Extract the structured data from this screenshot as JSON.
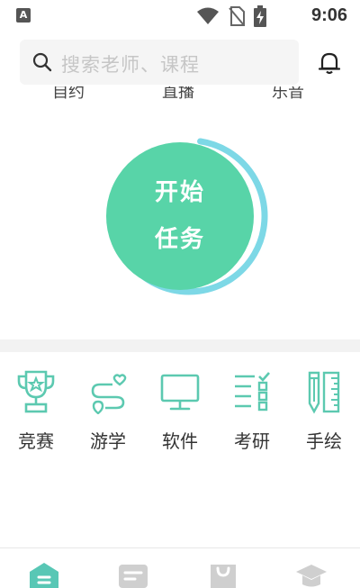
{
  "status": {
    "time": "9:06",
    "app_badge": "A"
  },
  "search": {
    "placeholder": "搜索老师、课程"
  },
  "cutoff_labels": [
    "自约",
    "直播",
    "乐音"
  ],
  "task_button": {
    "line1": "开始",
    "line2": "任务",
    "progress": 0.62
  },
  "categories": [
    {
      "label": "竞赛",
      "icon": "trophy-icon"
    },
    {
      "label": "游学",
      "icon": "route-icon"
    },
    {
      "label": "软件",
      "icon": "monitor-icon"
    },
    {
      "label": "考研",
      "icon": "checklist-icon"
    },
    {
      "label": "手绘",
      "icon": "pencil-ruler-icon"
    }
  ],
  "colors": {
    "accent": "#58d4a8",
    "icon": "#5cc9b0",
    "ring": "#7dd8e6"
  },
  "bottom_nav": [
    {
      "icon": "home-icon",
      "active": true
    },
    {
      "icon": "notes-icon",
      "active": false
    },
    {
      "icon": "shop-bag-icon",
      "active": false
    },
    {
      "icon": "graduation-cap-icon",
      "active": false
    }
  ]
}
